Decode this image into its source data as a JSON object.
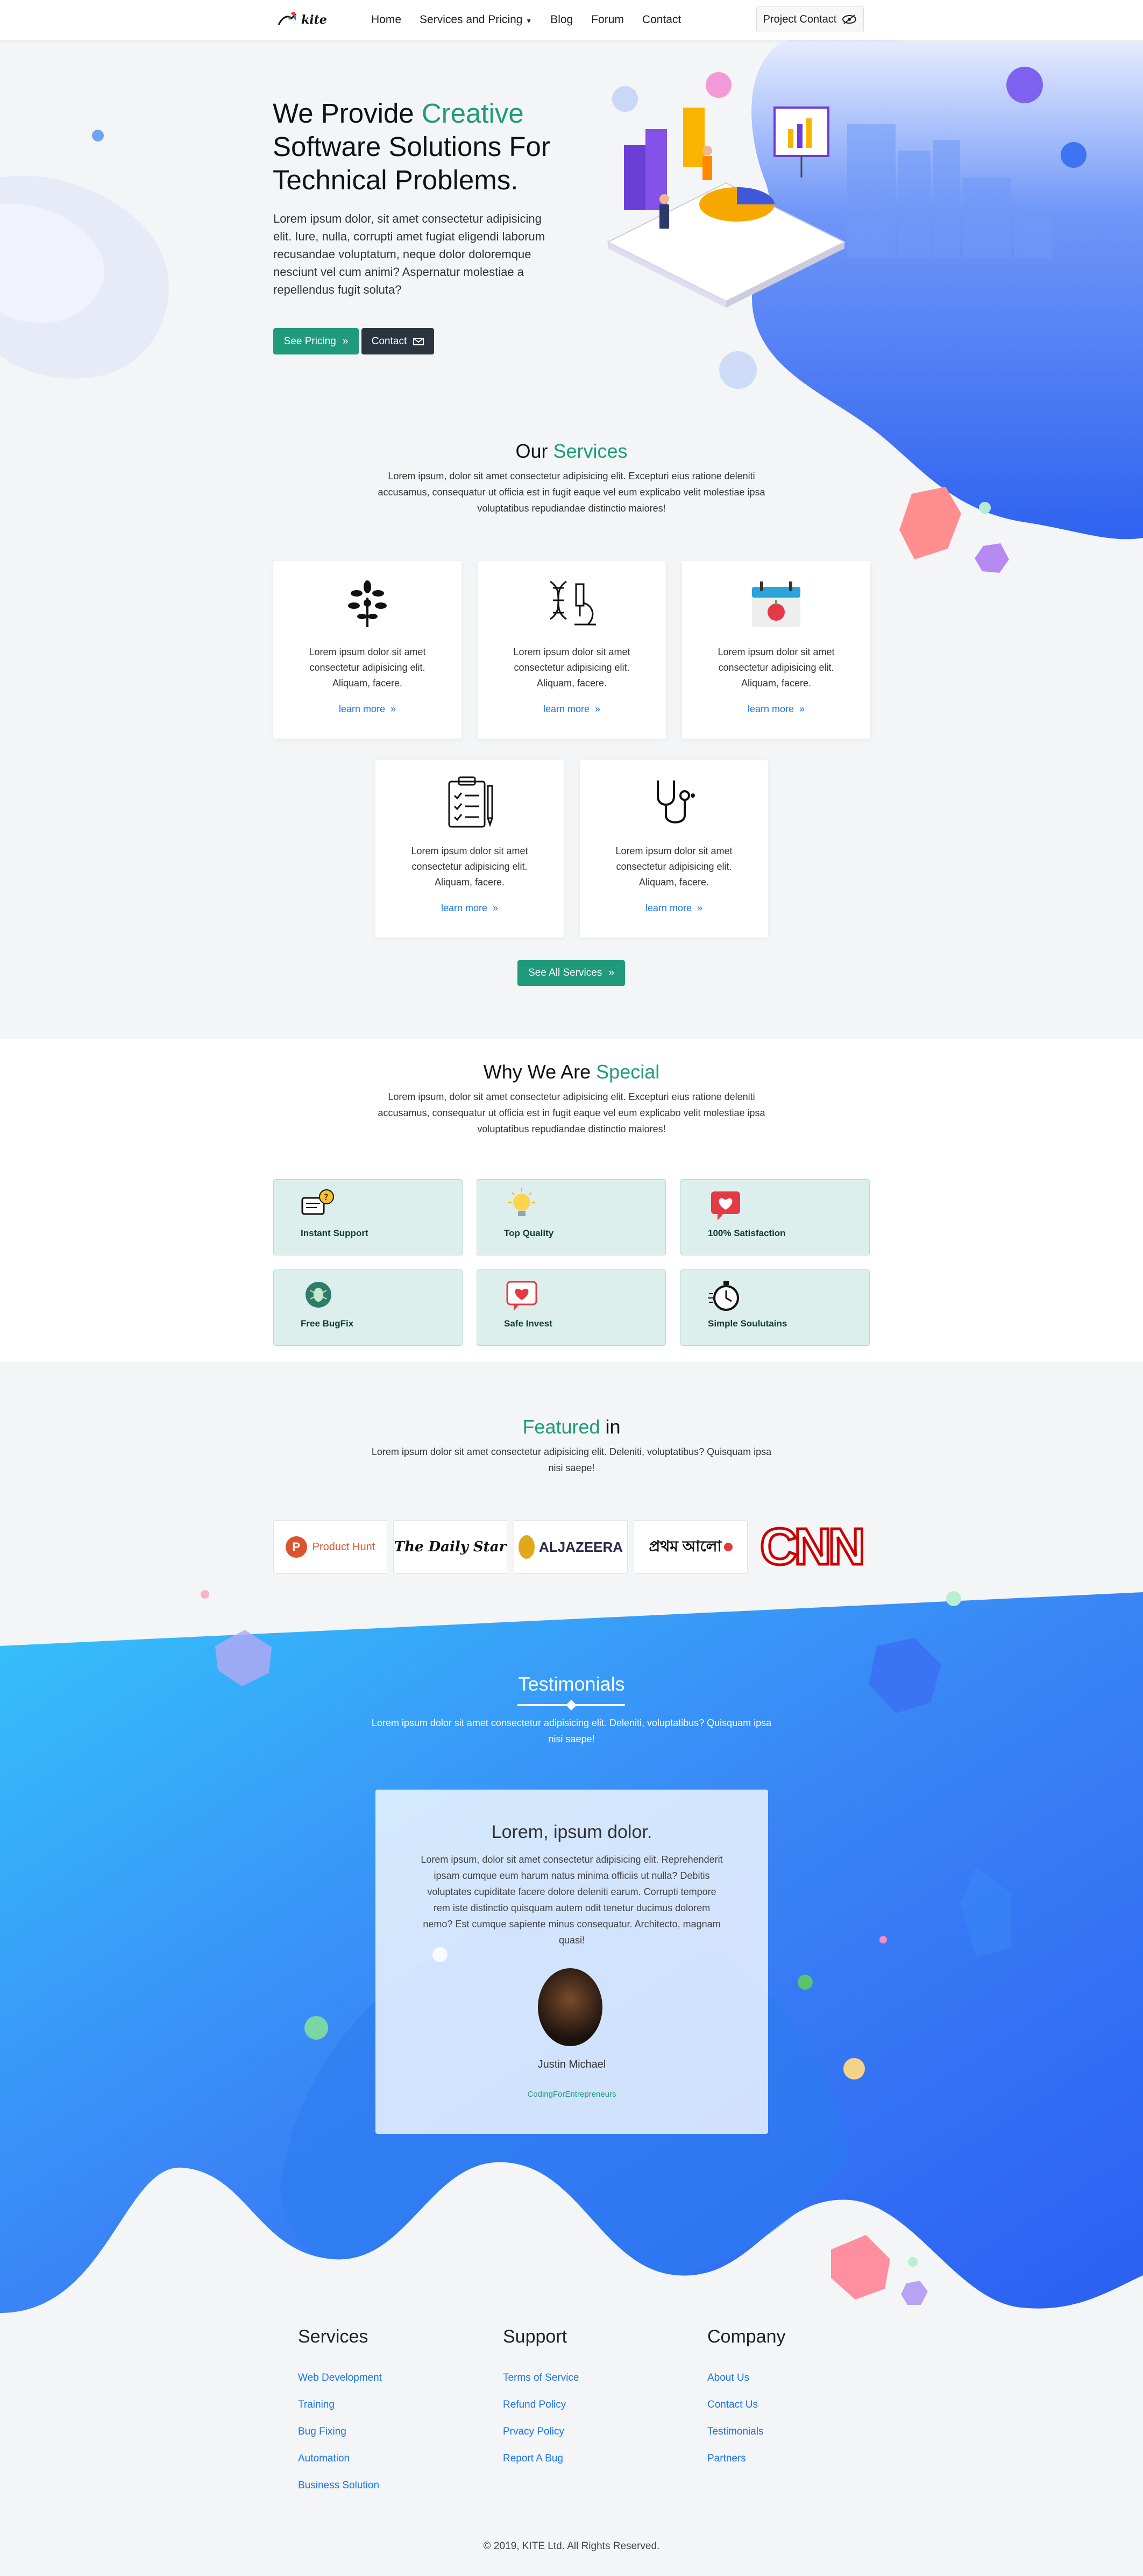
{
  "nav": {
    "brand": "kite",
    "links": [
      "Home",
      "Services and Pricing",
      "Blog",
      "Forum",
      "Contact"
    ],
    "project_contact": "Project Contact"
  },
  "hero": {
    "title_pre": "We Provide ",
    "title_accent": "Creative",
    "title_post": "Software Solutions For Technical Problems.",
    "desc": "Lorem ipsum dolor, sit amet consectetur adipisicing elit. Iure, nulla, corrupti amet fugiat eligendi laborum recusandae voluptatum, neque dolor doloremque nesciunt vel cum animi? Aspernatur molestiae a repellendus fugit soluta?",
    "btn_pricing": "See Pricing",
    "btn_contact": "Contact"
  },
  "services": {
    "title_pre": "Our ",
    "title_accent": "Services",
    "subtitle": "Lorem ipsum, dolor sit amet consectetur adipisicing elit. Excepturi eius ratione deleniti accusamus, consequatur ut officia est in fugit eaque vel eum explicabo velit molestiae ipsa voluptatibus repudiandae distinctio maiores!",
    "cards": [
      {
        "icon": "tree-icon",
        "text": "Lorem ipsum dolor sit amet consectetur adipisicing elit. Aliquam, facere.",
        "link": "learn more"
      },
      {
        "icon": "dna-microscope-icon",
        "text": "Lorem ipsum dolor sit amet consectetur adipisicing elit. Aliquam, facere.",
        "link": "learn more"
      },
      {
        "icon": "calendar-apple-icon",
        "text": "Lorem ipsum dolor sit amet consectetur adipisicing elit. Aliquam, facere.",
        "link": "learn more"
      },
      {
        "icon": "clipboard-checklist-icon",
        "text": "Lorem ipsum dolor sit amet consectetur adipisicing elit. Aliquam, facere.",
        "link": "learn more"
      },
      {
        "icon": "stethoscope-icon",
        "text": "Lorem ipsum dolor sit amet consectetur adipisicing elit. Aliquam, facere.",
        "link": "learn more"
      }
    ],
    "see_all": "See All Services"
  },
  "special": {
    "title_pre": "Why We Are ",
    "title_accent": "Special",
    "subtitle": "Lorem ipsum, dolor sit amet consectetur adipisicing elit. Excepturi eius ratione deleniti accusamus, consequatur ut officia est in fugit eaque vel eum explicabo velit molestiae ipsa voluptatibus repudiandae distinctio maiores!",
    "items": [
      "Instant Support",
      "Top Quality",
      "100% Satisfaction",
      "Free BugFix",
      "Safe Invest",
      "Simple Soulutains"
    ]
  },
  "featured": {
    "title_accent": "Featured",
    "title_post": " in",
    "subtitle": "Lorem ipsum dolor sit amet consectetur adipisicing elit. Deleniti, voluptatibus? Quisquam ipsa nisi saepe!",
    "logos": [
      "Product Hunt",
      "The Daily Star",
      "ALJAZEERA",
      "প্রথম আলো",
      "CNN"
    ]
  },
  "testimonials": {
    "title": "Testimonials",
    "subtitle": "Lorem ipsum dolor sit amet consectetur adipisicing elit. Deleniti, voluptatibus? Quisquam ipsa nisi saepe!",
    "card_title": "Lorem, ipsum dolor.",
    "card_text": "Lorem ipsum, dolor sit amet consectetur adipisicing elit. Reprehenderit ipsam cumque eum harum natus minima officiis ut nulla? Debitis voluptates cupiditate facere dolore deleniti earum. Corrupti tempore rem iste distinctio quisquam autem odit tenetur ducimus dolorem nemo? Est cumque sapiente minus consequatur. Architecto, magnam quasi!",
    "name": "Justin Michael",
    "role": "CodingForEntrepreneurs"
  },
  "footer": {
    "services_title": "Services",
    "services": [
      "Web Development",
      "Training",
      "Bug Fixing",
      "Automation",
      "Business Solution"
    ],
    "support_title": "Support",
    "support": [
      "Terms of Service",
      "Refund Policy",
      "Prvacy Policy",
      "Report A Bug"
    ],
    "company_title": "Company",
    "company": [
      "About Us",
      "Contact Us",
      "Testimonials",
      "Partners"
    ],
    "copyright": "© 2019, KITE Ltd. All Rights Reserved."
  },
  "colors": {
    "accent_green": "#1e9b7a",
    "brand_blue": "#2f6ff5",
    "link_blue": "#1a73e8"
  }
}
